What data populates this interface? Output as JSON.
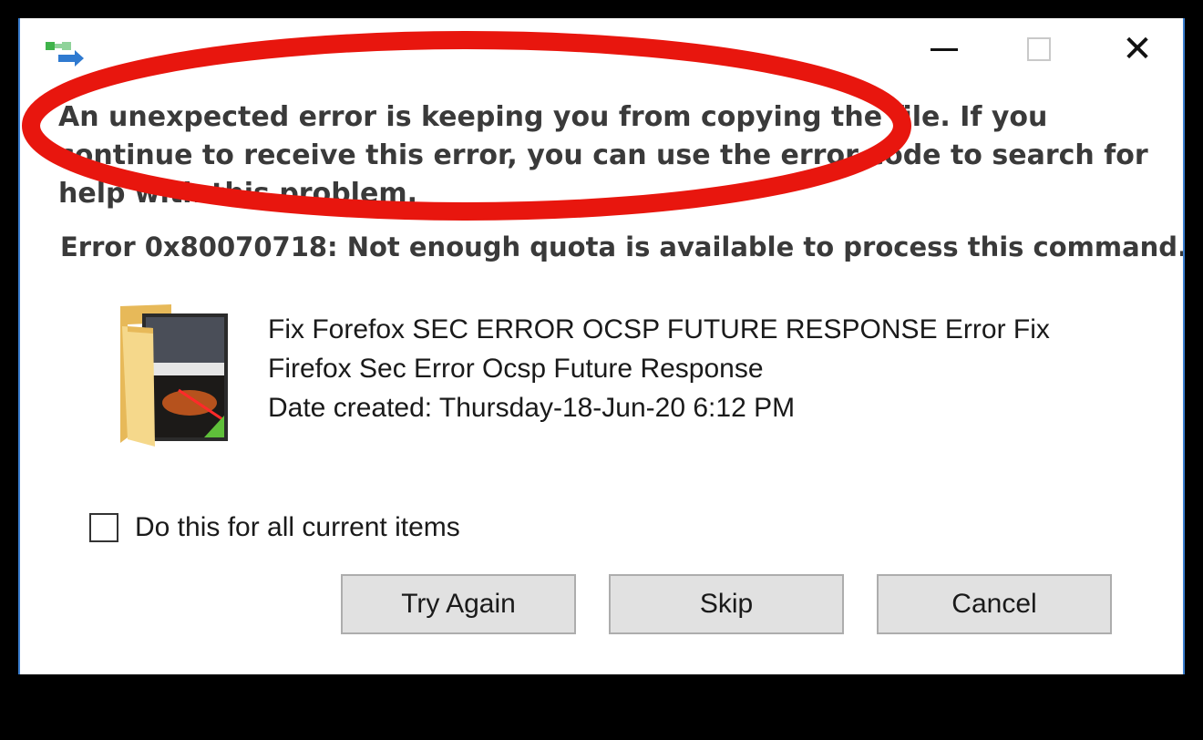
{
  "titlebar": {
    "app_icon": "file-copy-icon",
    "controls": {
      "minimize": "minimize-icon",
      "maximize": "maximize-icon",
      "close": "close-icon",
      "close_glyph": "✕"
    }
  },
  "dialog": {
    "message": "An unexpected error is keeping you from copying the file. If you continue to receive this error, you can use the error code to search for help with this problem.",
    "error_code": "Error 0x80070718: Not enough quota is available to process this command."
  },
  "file": {
    "icon": "folder-thumbnail-icon",
    "name_line1": "Fix Forefox SEC ERROR OCSP FUTURE RESPONSE Error  Fix",
    "name_line2": "Firefox Sec Error Ocsp Future Response",
    "date_created": "Date created: Thursday-18-Jun-20 6:12 PM"
  },
  "options": {
    "checkbox_label": "Do this for all current items",
    "checked": false
  },
  "buttons": {
    "try_again": "Try Again",
    "skip": "Skip",
    "cancel": "Cancel"
  },
  "colors": {
    "annotation": "#e8160e",
    "button_bg": "#e1e1e1",
    "window_border": "#3b7fd0"
  }
}
